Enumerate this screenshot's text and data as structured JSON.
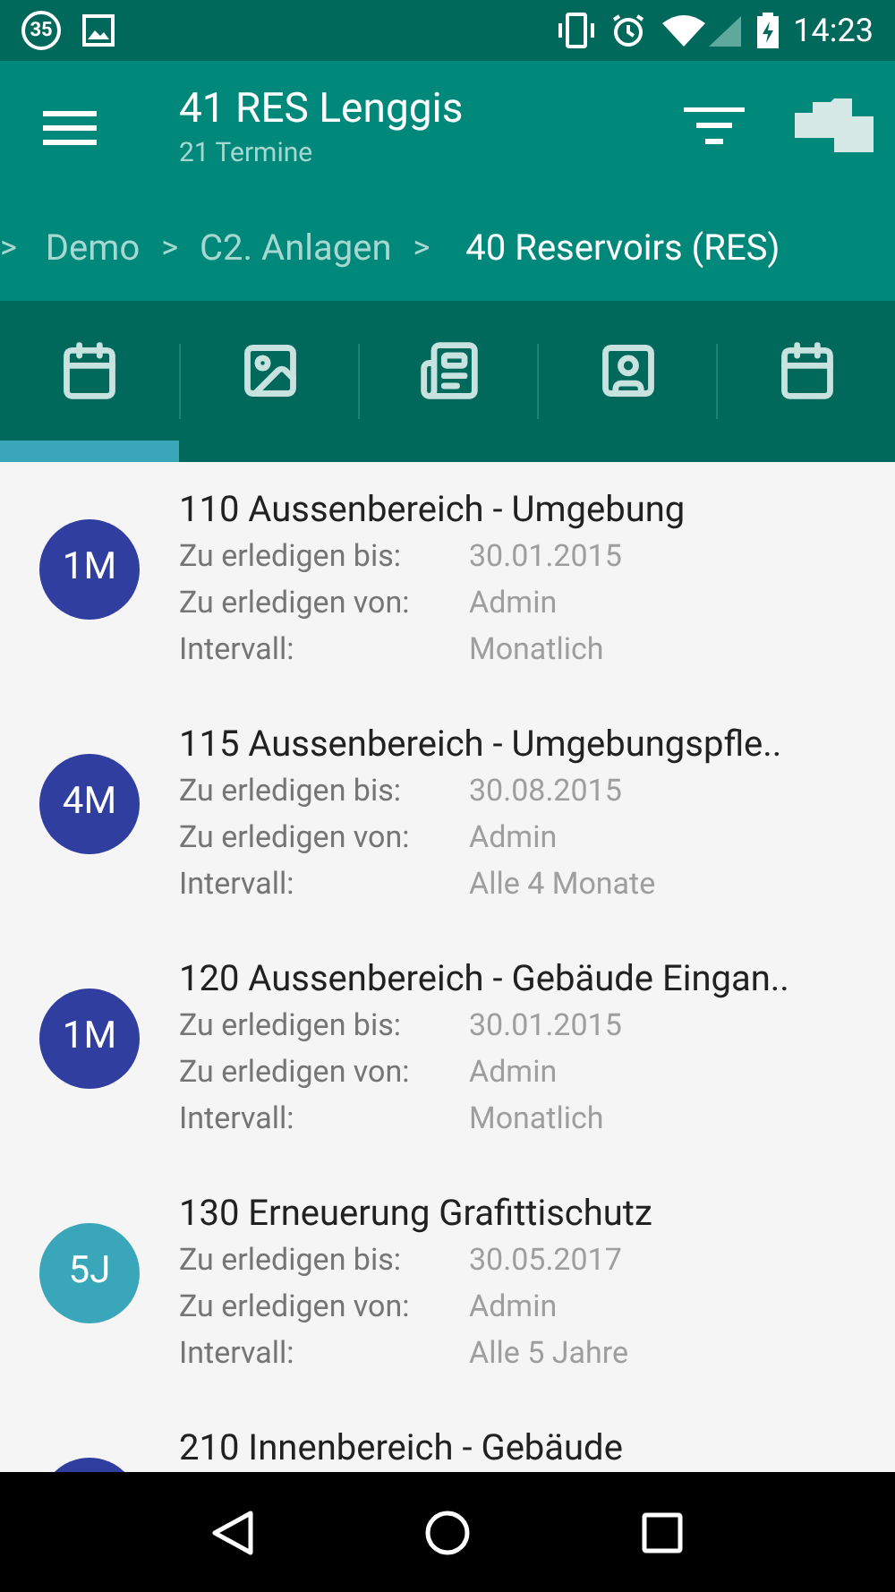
{
  "status_bar": {
    "notification_count": "35",
    "time": "14:23"
  },
  "toolbar": {
    "title": "41 RES Lenggis",
    "subtitle": "21 Termine"
  },
  "breadcrumbs": [
    {
      "label": ">",
      "kind": "separator"
    },
    {
      "label": "Demo",
      "kind": "link",
      "current": false
    },
    {
      "label": ">",
      "kind": "separator"
    },
    {
      "label": "C2. Anlagen",
      "kind": "link",
      "current": false
    },
    {
      "label": ">",
      "kind": "separator"
    },
    {
      "label": "40 Reservoirs (RES)",
      "kind": "link",
      "current": true
    }
  ],
  "tabs": [
    {
      "kind": "calendar",
      "selected": true
    },
    {
      "kind": "image",
      "selected": false
    },
    {
      "kind": "newspaper",
      "selected": false
    },
    {
      "kind": "contact",
      "selected": false
    },
    {
      "kind": "calendar",
      "selected": false
    }
  ],
  "appointments": [
    {
      "badge": "1M",
      "color": "#303f9f",
      "title": "110 Aussenbereich - Umgebung",
      "fields": [
        {
          "label": "Zu erledigen bis:",
          "value": "30.01.2015"
        },
        {
          "label": "Zu erledigen von:",
          "value": "Admin"
        },
        {
          "label": "Intervall:",
          "value": "Monatlich"
        }
      ]
    },
    {
      "badge": "4M",
      "color": "#303f9f",
      "title": "115 Aussenbereich - Umgebungspfle..",
      "fields": [
        {
          "label": "Zu erledigen bis:",
          "value": "30.08.2015"
        },
        {
          "label": "Zu erledigen von:",
          "value": "Admin"
        },
        {
          "label": "Intervall:",
          "value": "Alle 4 Monate"
        }
      ]
    },
    {
      "badge": "1M",
      "color": "#303f9f",
      "title": "120 Aussenbereich - Gebäude Eingan..",
      "fields": [
        {
          "label": "Zu erledigen bis:",
          "value": "30.01.2015"
        },
        {
          "label": "Zu erledigen von:",
          "value": "Admin"
        },
        {
          "label": "Intervall:",
          "value": "Monatlich"
        }
      ]
    },
    {
      "badge": "5J",
      "color": "#3aa6b9",
      "title": "130 Erneuerung Grafittischutz",
      "fields": [
        {
          "label": "Zu erledigen bis:",
          "value": "30.05.2017"
        },
        {
          "label": "Zu erledigen von:",
          "value": "Admin"
        },
        {
          "label": "Intervall:",
          "value": "Alle 5 Jahre"
        }
      ]
    },
    {
      "color": "#303f9f",
      "title": "210 Innenbereich - Gebäude"
    }
  ]
}
